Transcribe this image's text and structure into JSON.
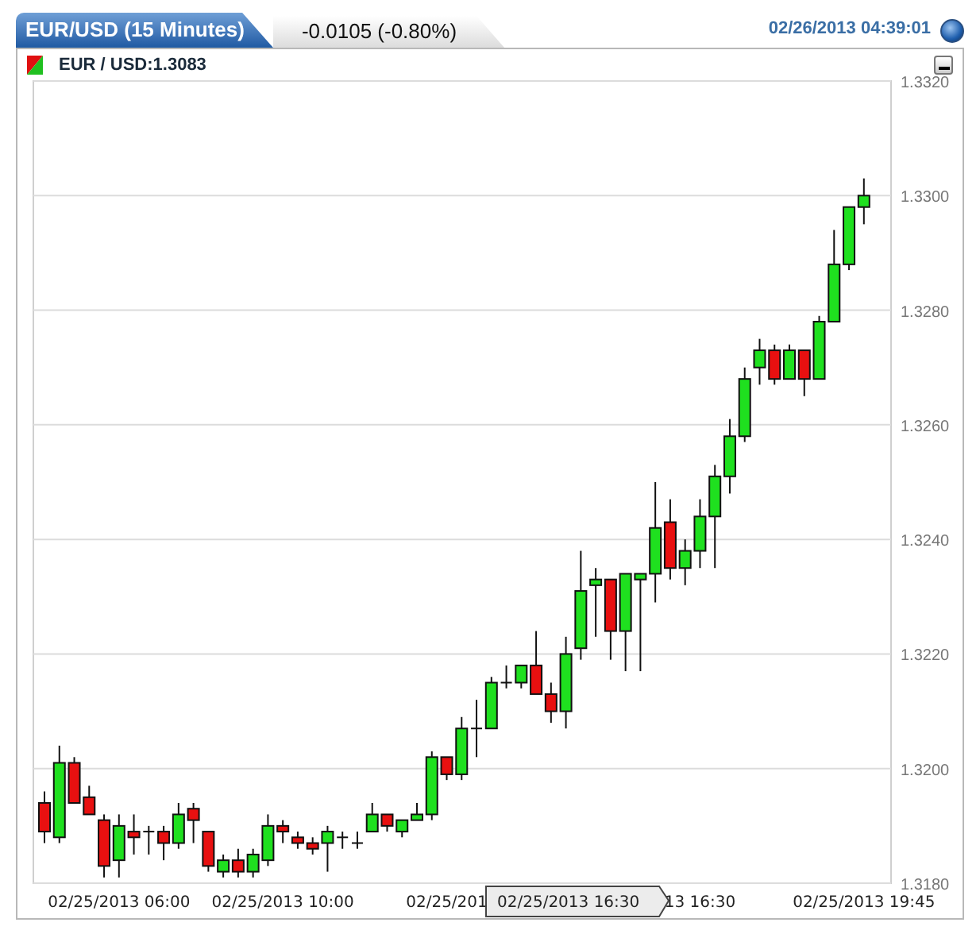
{
  "header": {
    "tabs": [
      {
        "label": "EUR/USD (15 Minutes)",
        "selected": true
      },
      {
        "label": "-0.0105 (-0.80%)",
        "selected": false
      }
    ],
    "timestamp": "02/26/2013 04:39:01"
  },
  "chart_panel": {
    "legend": "EUR / USD:1.3083",
    "crosshair_label": "02/25/2013 16:30",
    "chart_data": {
      "type": "candlestick",
      "grid": true,
      "ylim": [
        1.318,
        1.332
      ],
      "yticks": [
        {
          "value": 1.332,
          "label": "1.3320"
        },
        {
          "value": 1.33,
          "label": "1.3300"
        },
        {
          "value": 1.328,
          "label": "1.3280"
        },
        {
          "value": 1.326,
          "label": "1.3260"
        },
        {
          "value": 1.324,
          "label": "1.3240"
        },
        {
          "value": 1.322,
          "label": "1.3220"
        },
        {
          "value": 1.32,
          "label": "1.3200"
        },
        {
          "value": 1.318,
          "label": "1.3180"
        }
      ],
      "categories": [
        null,
        null,
        null,
        null,
        null,
        "02/25/2013 06:00",
        null,
        null,
        null,
        null,
        null,
        null,
        null,
        null,
        null,
        null,
        "02/25/2013 10:00",
        null,
        null,
        null,
        null,
        null,
        null,
        null,
        null,
        null,
        null,
        "02/25/201",
        null,
        null,
        null,
        null,
        null,
        null,
        null,
        null,
        null,
        null,
        null,
        null,
        null,
        null,
        null,
        null,
        "13 16:30",
        null,
        null,
        null,
        null,
        null,
        null,
        null,
        null,
        null,
        null,
        "02/25/2013 19:45"
      ],
      "ohlc": [
        [
          1.3194,
          1.3196,
          1.3187,
          1.3189
        ],
        [
          1.3188,
          1.3204,
          1.3187,
          1.3201
        ],
        [
          1.3201,
          1.3202,
          1.3194,
          1.3194
        ],
        [
          1.3195,
          1.3197,
          1.3192,
          1.3192
        ],
        [
          1.3191,
          1.3192,
          1.3181,
          1.3183
        ],
        [
          1.3184,
          1.3192,
          1.3181,
          1.319
        ],
        [
          1.3189,
          1.3192,
          1.3185,
          1.3188
        ],
        [
          1.3189,
          1.319,
          1.3185,
          1.3189
        ],
        [
          1.3189,
          1.319,
          1.3184,
          1.3187
        ],
        [
          1.3187,
          1.3194,
          1.3186,
          1.3192
        ],
        [
          1.3193,
          1.3194,
          1.3187,
          1.3191
        ],
        [
          1.3189,
          1.3189,
          1.3182,
          1.3183
        ],
        [
          1.3182,
          1.3185,
          1.3181,
          1.3184
        ],
        [
          1.3184,
          1.3186,
          1.3181,
          1.3182
        ],
        [
          1.3182,
          1.3186,
          1.3181,
          1.3185
        ],
        [
          1.3184,
          1.3192,
          1.3183,
          1.319
        ],
        [
          1.319,
          1.3191,
          1.3187,
          1.3189
        ],
        [
          1.3188,
          1.3189,
          1.3186,
          1.3187
        ],
        [
          1.3187,
          1.3188,
          1.3185,
          1.3186
        ],
        [
          1.3187,
          1.319,
          1.3182,
          1.3189
        ],
        [
          1.3188,
          1.3189,
          1.3186,
          1.3188
        ],
        [
          1.3187,
          1.3189,
          1.3186,
          1.3187
        ],
        [
          1.3189,
          1.3194,
          1.3189,
          1.3192
        ],
        [
          1.3192,
          1.3192,
          1.3189,
          1.319
        ],
        [
          1.3189,
          1.3191,
          1.3188,
          1.3191
        ],
        [
          1.3191,
          1.3194,
          1.3191,
          1.3192
        ],
        [
          1.3192,
          1.3203,
          1.3191,
          1.3202
        ],
        [
          1.3202,
          1.3202,
          1.3198,
          1.3199
        ],
        [
          1.3199,
          1.3209,
          1.3198,
          1.3207
        ],
        [
          1.3207,
          1.3212,
          1.3202,
          1.3207
        ],
        [
          1.3207,
          1.3216,
          1.3207,
          1.3215
        ],
        [
          1.3215,
          1.3218,
          1.3214,
          1.3215
        ],
        [
          1.3215,
          1.3218,
          1.3214,
          1.3218
        ],
        [
          1.3218,
          1.3224,
          1.3213,
          1.3213
        ],
        [
          1.3213,
          1.3215,
          1.3208,
          1.321
        ],
        [
          1.321,
          1.3223,
          1.3207,
          1.322
        ],
        [
          1.3221,
          1.3238,
          1.3219,
          1.3231
        ],
        [
          1.3232,
          1.3235,
          1.3223,
          1.3233
        ],
        [
          1.3233,
          1.3233,
          1.3219,
          1.3224
        ],
        [
          1.3224,
          1.3234,
          1.3217,
          1.3234
        ],
        [
          1.3233,
          1.3234,
          1.3217,
          1.3234
        ],
        [
          1.3234,
          1.325,
          1.3229,
          1.3242
        ],
        [
          1.3243,
          1.3247,
          1.3233,
          1.3235
        ],
        [
          1.3235,
          1.324,
          1.3232,
          1.3238
        ],
        [
          1.3238,
          1.3247,
          1.3235,
          1.3244
        ],
        [
          1.3244,
          1.3253,
          1.3235,
          1.3251
        ],
        [
          1.3251,
          1.3261,
          1.3248,
          1.3258
        ],
        [
          1.3258,
          1.327,
          1.3257,
          1.3268
        ],
        [
          1.327,
          1.3275,
          1.3267,
          1.3273
        ],
        [
          1.3273,
          1.3274,
          1.3267,
          1.3268
        ],
        [
          1.3268,
          1.3274,
          1.3268,
          1.3273
        ],
        [
          1.3273,
          1.3273,
          1.3265,
          1.3268
        ],
        [
          1.3268,
          1.3279,
          1.3268,
          1.3278
        ],
        [
          1.3278,
          1.3294,
          1.3278,
          1.3288
        ],
        [
          1.3288,
          1.3298,
          1.3287,
          1.3298
        ],
        [
          1.3298,
          1.3303,
          1.3295,
          1.33
        ]
      ]
    }
  }
}
